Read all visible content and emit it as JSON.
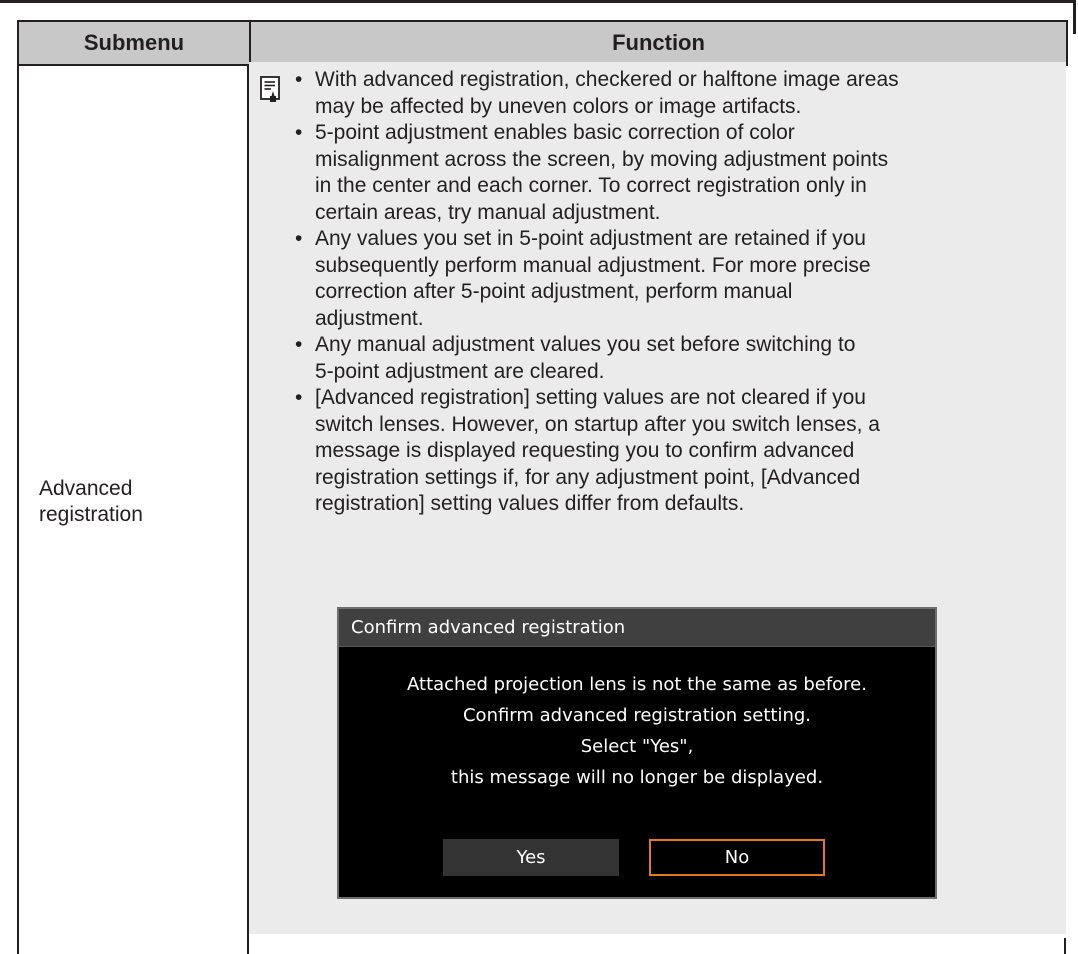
{
  "table": {
    "header": {
      "submenu": "Submenu",
      "function": "Function"
    },
    "row": {
      "submenu_label": "Advanced registration"
    }
  },
  "note": {
    "icon": "note-icon",
    "bullets": [
      "With advanced registration, checkered or halftone image areas may be affected by uneven colors or image artifacts.",
      "5-point adjustment enables basic correction of color misalignment across the screen, by moving adjustment points in the center and each corner. To correct registration only in certain areas, try manual adjustment.",
      "Any values you set in 5-point adjustment are retained if you subsequently perform manual adjustment. For more precise correction after 5-point adjustment, perform manual adjustment.",
      "Any manual adjustment values you set before switching to 5-point adjustment are cleared.",
      "[Advanced registration] setting values are not cleared if you switch lenses. However, on startup after you switch lenses, a message is displayed requesting you to confirm advanced registration settings if, for any adjustment point, [Advanced registration] setting values differ from defaults."
    ],
    "bullet_lines": [
      [
        "With advanced registration, checkered or halftone image areas",
        "may be affected by uneven colors or image artifacts."
      ],
      [
        "5-point adjustment enables basic correction of color",
        "misalignment across the screen, by moving adjustment points",
        "in the center and each corner. To correct registration only in",
        "certain areas, try manual adjustment."
      ],
      [
        "Any values you set in 5-point adjustment are retained if you",
        "subsequently perform manual adjustment. For more precise",
        "correction after 5-point adjustment, perform manual",
        "adjustment."
      ],
      [
        "Any manual adjustment values you set before switching to",
        "5-point adjustment are cleared."
      ],
      [
        "[Advanced registration] setting values are not cleared if you",
        "switch lenses. However, on startup after you switch lenses, a",
        "message is displayed requesting you to confirm advanced",
        "registration settings if, for any adjustment point, [Advanced",
        "registration] setting values differ from defaults."
      ]
    ]
  },
  "dialog": {
    "title": "Confirm advanced registration",
    "message_lines": [
      "Attached projection lens is not the same as before.",
      "Confirm advanced registration setting.",
      "Select \"Yes\",",
      "this message will no longer be displayed."
    ],
    "yes_label": "Yes",
    "no_label": "No",
    "focused_button": "No",
    "colors": {
      "focus_border": "#e07a1a",
      "title_bar": "#404040",
      "background": "#000000"
    }
  }
}
